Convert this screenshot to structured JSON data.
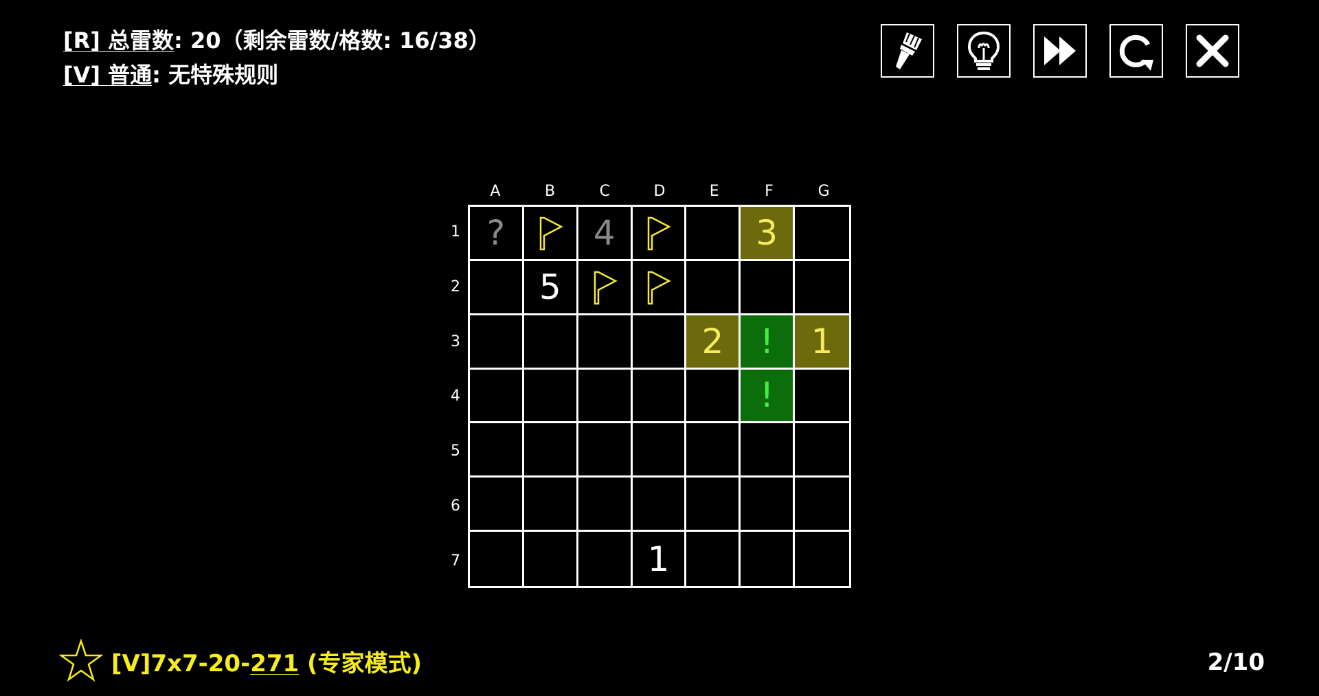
{
  "rules": {
    "line1": {
      "key": "[R]",
      "name": "总雷数",
      "sep": ":",
      "value": "20（剩余雷数/格数: 16/38）"
    },
    "line2": {
      "key": "[V]",
      "name": "普通",
      "sep": ":",
      "value": "无特殊规则"
    }
  },
  "toolbar": [
    {
      "name": "brush-button",
      "icon": "brush-icon"
    },
    {
      "name": "hint-button",
      "icon": "lightbulb-icon"
    },
    {
      "name": "skip-button",
      "icon": "fast-forward-icon"
    },
    {
      "name": "restart-button",
      "icon": "restart-icon"
    },
    {
      "name": "close-button",
      "icon": "close-icon"
    }
  ],
  "board": {
    "columns": [
      "A",
      "B",
      "C",
      "D",
      "E",
      "F",
      "G"
    ],
    "rows": [
      "1",
      "2",
      "3",
      "4",
      "5",
      "6",
      "7"
    ],
    "cells": [
      [
        {
          "t": "?",
          "s": "gray"
        },
        {
          "t": "flag"
        },
        {
          "t": "4",
          "s": "gray"
        },
        {
          "t": "flag"
        },
        {
          "t": ""
        },
        {
          "t": "3",
          "s": "olive"
        },
        {
          "t": ""
        }
      ],
      [
        {
          "t": ""
        },
        {
          "t": "5",
          "s": "white"
        },
        {
          "t": "flag"
        },
        {
          "t": "flag"
        },
        {
          "t": ""
        },
        {
          "t": ""
        },
        {
          "t": ""
        }
      ],
      [
        {
          "t": ""
        },
        {
          "t": ""
        },
        {
          "t": ""
        },
        {
          "t": ""
        },
        {
          "t": "2",
          "s": "olive"
        },
        {
          "t": "!",
          "s": "green"
        },
        {
          "t": "1",
          "s": "olive"
        }
      ],
      [
        {
          "t": ""
        },
        {
          "t": ""
        },
        {
          "t": ""
        },
        {
          "t": ""
        },
        {
          "t": ""
        },
        {
          "t": "!",
          "s": "green"
        },
        {
          "t": ""
        }
      ],
      [
        {
          "t": ""
        },
        {
          "t": ""
        },
        {
          "t": ""
        },
        {
          "t": ""
        },
        {
          "t": ""
        },
        {
          "t": ""
        },
        {
          "t": ""
        }
      ],
      [
        {
          "t": ""
        },
        {
          "t": ""
        },
        {
          "t": ""
        },
        {
          "t": ""
        },
        {
          "t": ""
        },
        {
          "t": ""
        },
        {
          "t": ""
        }
      ],
      [
        {
          "t": ""
        },
        {
          "t": ""
        },
        {
          "t": ""
        },
        {
          "t": "1",
          "s": "white"
        },
        {
          "t": ""
        },
        {
          "t": ""
        },
        {
          "t": ""
        }
      ]
    ]
  },
  "footer": {
    "level_prefix": "[V]7x7-20-",
    "level_id": "271",
    "level_suffix": " (专家模式)",
    "page": "2/10"
  },
  "colors": {
    "accent_yellow": "#f7ec1c",
    "flag_yellow": "#f4e93a",
    "olive_cell": "#6c6a0c",
    "green_cell": "#0b6e0b",
    "green_text": "#48ea48"
  }
}
